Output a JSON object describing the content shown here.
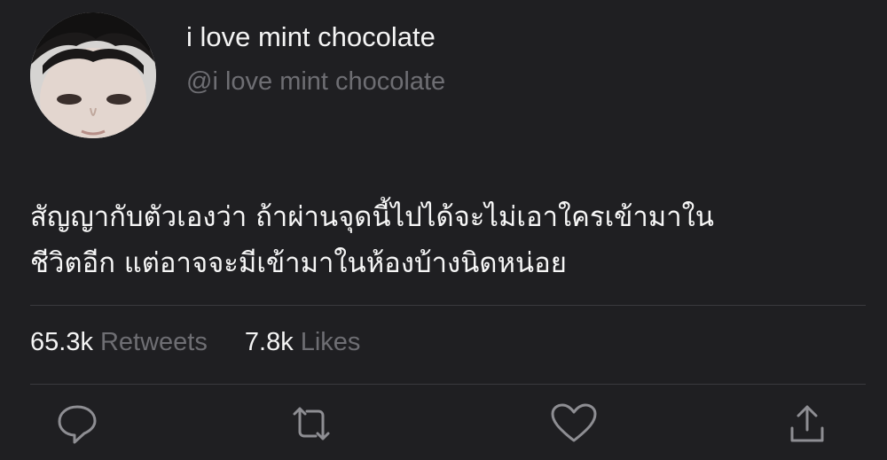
{
  "profile": {
    "display_name": "i love mint chocolate",
    "handle": "@i love mint chocolate"
  },
  "tweet": {
    "text_lines": [
      "สัญญากับตัวเองว่า ถ้าผ่านจุดนี้ไปได้จะไม่เอาใครเข้ามาใน",
      "ชีวิตอีก แต่อาจจะมีเข้ามาในห้องบ้างนิดหน่อย"
    ]
  },
  "stats": {
    "retweets_count": "65.3k",
    "retweets_label": "Retweets",
    "likes_count": "7.8k",
    "likes_label": "Likes"
  },
  "actions": {
    "reply_icon": "reply-icon",
    "retweet_icon": "retweet-icon",
    "like_icon": "heart-icon",
    "share_icon": "share-icon"
  },
  "colors": {
    "background": "#1f1f22",
    "primary_text": "#f4f4f4",
    "secondary_text": "#6e6e73",
    "divider": "#3a3a3e",
    "icon": "#8e8e93"
  }
}
